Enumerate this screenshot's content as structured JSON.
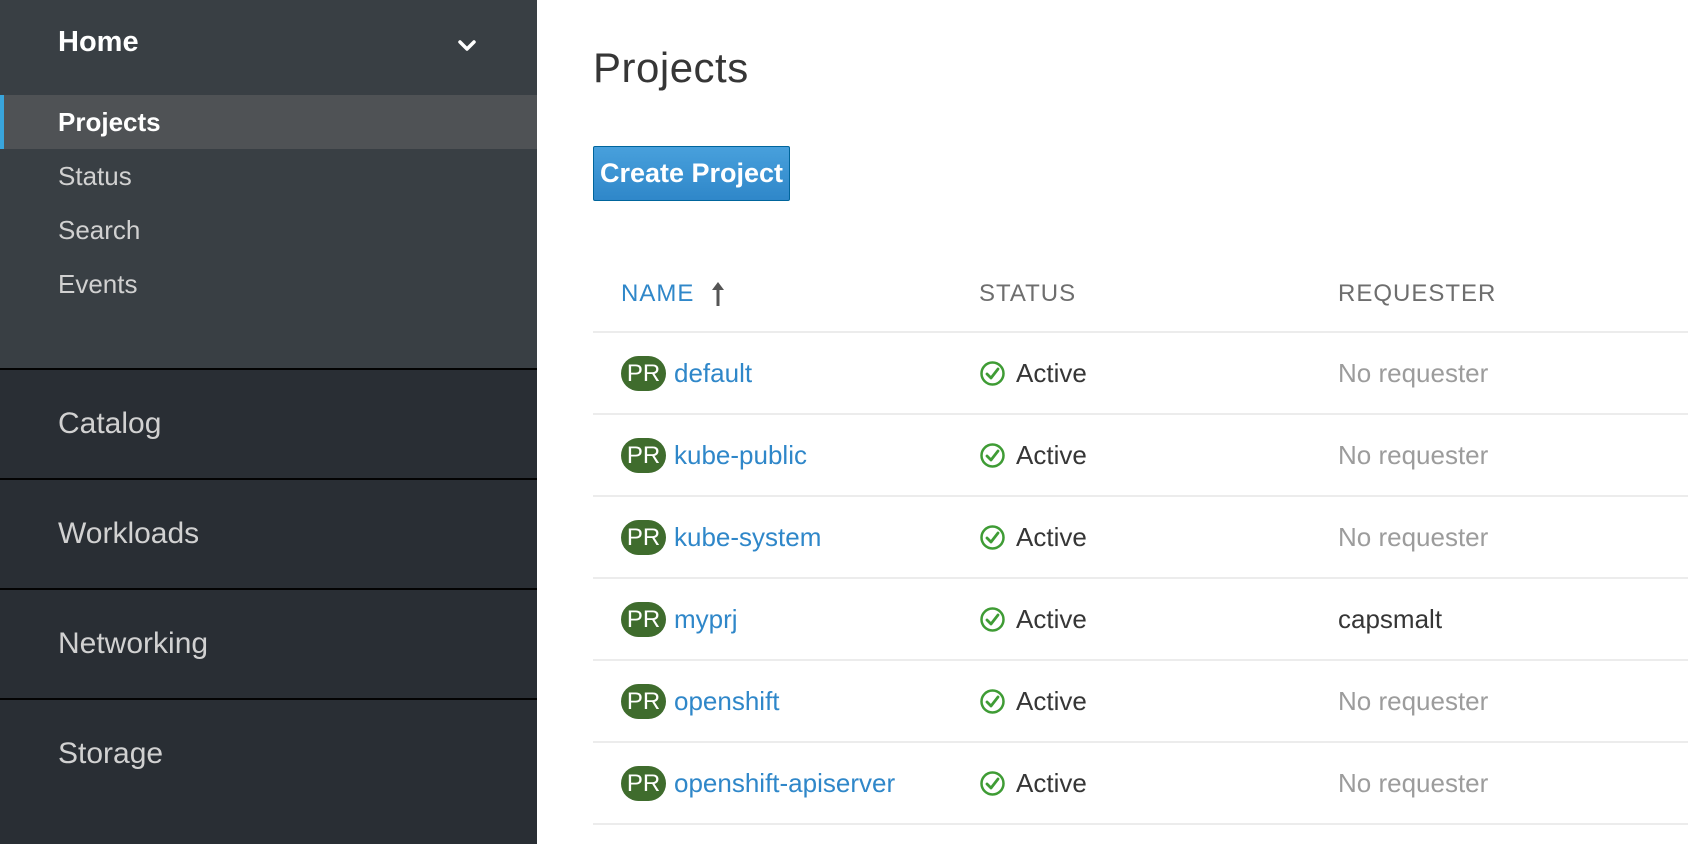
{
  "sidebar": {
    "home": {
      "title": "Home",
      "items": [
        {
          "label": "Projects",
          "active": true
        },
        {
          "label": "Status"
        },
        {
          "label": "Search"
        },
        {
          "label": "Events"
        }
      ]
    },
    "sections": [
      "Catalog",
      "Workloads",
      "Networking",
      "Storage"
    ],
    "colors": {
      "background": "#292e34",
      "home_bg": "#393f44",
      "active_bg": "#4f5255",
      "active_accent": "#39a5dc"
    }
  },
  "main": {
    "title": "Projects",
    "create_button": "Create Project",
    "table": {
      "headers": {
        "name": "NAME",
        "status": "STATUS",
        "requester": "REQUESTER"
      },
      "sort_icon": "arrow-up-icon",
      "rows": [
        {
          "badge": "PR",
          "name": "default",
          "status": "Active",
          "requester": "No requester"
        },
        {
          "badge": "PR",
          "name": "kube-public",
          "status": "Active",
          "requester": "No requester"
        },
        {
          "badge": "PR",
          "name": "kube-system",
          "status": "Active",
          "requester": "No requester"
        },
        {
          "badge": "PR",
          "name": "myprj",
          "status": "Active",
          "requester": "capsmalt"
        },
        {
          "badge": "PR",
          "name": "openshift",
          "status": "Active",
          "requester": "No requester"
        },
        {
          "badge": "PR",
          "name": "openshift-apiserver",
          "status": "Active",
          "requester": "No requester"
        }
      ]
    },
    "colors": {
      "link": "#2f87c9",
      "badge": "#3f6c2d",
      "status_ok": "#3f9c35",
      "button": "#2f87c9"
    }
  }
}
